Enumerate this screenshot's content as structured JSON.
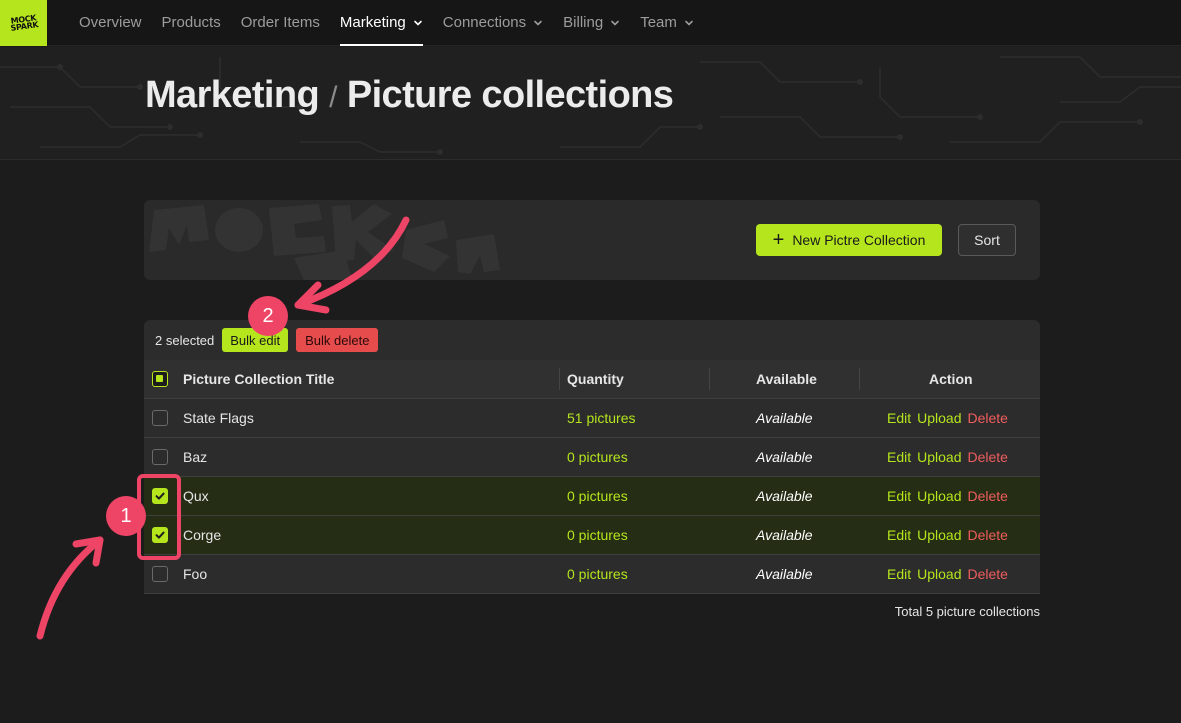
{
  "brand": {
    "logo_text_line1": "MOCK",
    "logo_text_line2": "SPARK",
    "accent": "#b5e61d"
  },
  "nav": {
    "items": [
      {
        "label": "Overview",
        "dropdown": false,
        "active": false
      },
      {
        "label": "Products",
        "dropdown": false,
        "active": false
      },
      {
        "label": "Order Items",
        "dropdown": false,
        "active": false
      },
      {
        "label": "Marketing",
        "dropdown": true,
        "active": true
      },
      {
        "label": "Connections",
        "dropdown": true,
        "active": false
      },
      {
        "label": "Billing",
        "dropdown": true,
        "active": false
      },
      {
        "label": "Team",
        "dropdown": true,
        "active": false
      }
    ]
  },
  "header": {
    "breadcrumb_parent": "Marketing",
    "separator": "/",
    "title": "Picture collections"
  },
  "toolbar": {
    "new_button_label": "New Pictre Collection",
    "sort_button_label": "Sort"
  },
  "bulk": {
    "selected_text": "2 selected",
    "edit_label": "Bulk edit",
    "delete_label": "Bulk delete"
  },
  "table": {
    "columns": [
      "Picture Collection Title",
      "Quantity",
      "Available",
      "Action"
    ],
    "rows": [
      {
        "title": "State Flags",
        "quantity": "51 pictures",
        "available": "Available",
        "selected": false
      },
      {
        "title": "Baz",
        "quantity": "0 pictures",
        "available": "Available",
        "selected": false
      },
      {
        "title": "Qux",
        "quantity": "0 pictures",
        "available": "Available",
        "selected": true
      },
      {
        "title": "Corge",
        "quantity": "0 pictures",
        "available": "Available",
        "selected": true
      },
      {
        "title": "Foo",
        "quantity": "0 pictures",
        "available": "Available",
        "selected": false
      }
    ],
    "actions": {
      "edit": "Edit",
      "upload": "Upload",
      "delete": "Delete"
    }
  },
  "footer": {
    "total_text": "Total 5 picture collections"
  },
  "annotations": {
    "badge_1": "1",
    "badge_2": "2",
    "color": "#ee4466"
  }
}
